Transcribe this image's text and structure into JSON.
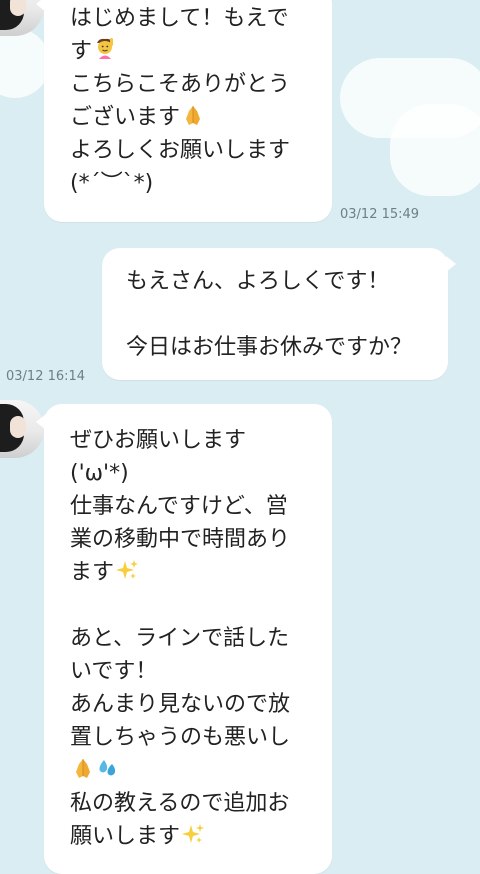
{
  "theme": {
    "background": "#d9edf3",
    "bubble": "#ffffff",
    "text": "#222222",
    "timestamp": "#6e7f86"
  },
  "messages": [
    {
      "sender": "them",
      "time": "03/12 15:49",
      "lines": [
        {
          "text": "はじめまして！もえで"
        },
        {
          "text": "す",
          "emoji": "raising-hand-woman-icon"
        },
        {
          "text": "こちらこそありがとう"
        },
        {
          "text": "ございます",
          "emoji": "folded-hands-icon"
        },
        {
          "text": "よろしくお願いします"
        },
        {
          "text": "(*´︶`*)"
        }
      ]
    },
    {
      "sender": "me",
      "time": "03/12 16:14",
      "lines": [
        {
          "text": "もえさん、よろしくです！"
        },
        {
          "text": ""
        },
        {
          "text": "今日はお仕事お休みですか？"
        }
      ]
    },
    {
      "sender": "them",
      "lines": [
        {
          "text": "ぜひお願いします"
        },
        {
          "text": "('ω'*)"
        },
        {
          "text": "仕事なんですけど、営"
        },
        {
          "text": "業の移動中で時間あり"
        },
        {
          "text": "ます",
          "emoji": "sparkles-icon"
        },
        {
          "text": ""
        },
        {
          "text": "あと、ラインで話した"
        },
        {
          "text": "いです！"
        },
        {
          "text": "あんまり見ないので放"
        },
        {
          "text": "置しちゃうのも悪いし"
        },
        {
          "text": "",
          "emoji": "folded-hands-sweat-icon"
        },
        {
          "text": "私の教えるので追加お"
        },
        {
          "text": "願いします",
          "emoji": "sparkles-icon"
        }
      ]
    }
  ]
}
